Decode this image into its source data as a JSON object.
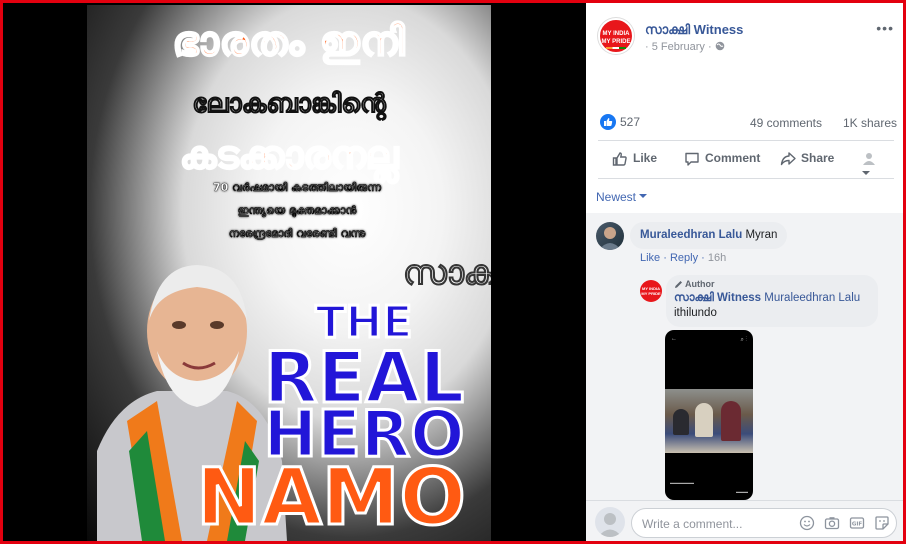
{
  "poster": {
    "line1": "ഭാരതം ഇനി",
    "line2": "ലോകബാങ്കിന്റെ",
    "line3": "കടക്കാരനല്ല",
    "line4": "70 വർഷമായി കടത്തിലായിരുന്ന",
    "line5": "ഇന്ത്യയെ മുക്തമാക്കാൻ",
    "line6": "നരേന്ദ്രമോദി വരേണ്ടി വന്നു",
    "watermark": "സാക്ഷി",
    "hero_the": "THE",
    "hero_real": "REAL",
    "hero_hero": "HERO",
    "hero_namo": "NAMO"
  },
  "post": {
    "page_name": "സാക്ഷി Witness",
    "date": "5 February",
    "date_separator": "·",
    "avatar_text": "MY INDIA MY PRIDE",
    "more": "•••"
  },
  "stats": {
    "reactions": "527",
    "comments": "49 comments",
    "shares": "1K shares"
  },
  "actions": {
    "like": "Like",
    "comment": "Comment",
    "share": "Share"
  },
  "sort": {
    "label": "Newest"
  },
  "comment1": {
    "author": "Muraleedhran Lalu",
    "text": "Myran",
    "like": "Like",
    "reply": "Reply",
    "time": "16h"
  },
  "comment2": {
    "author_tag": "Author",
    "author": "സാക്ഷി Witness",
    "mention": "Muraleedhran Lalu",
    "text": "ithilundo",
    "avatar_text": "MY INDIA MY PRIDE"
  },
  "composer": {
    "placeholder": "Write a comment..."
  },
  "colors": {
    "link": "#385898",
    "accent_red": "#e3000f",
    "poster_orange": "#ff5a12",
    "poster_blue": "#2216d8"
  },
  "icons": {
    "like": "thumbs-up-icon",
    "comment": "speech-bubble-icon",
    "share": "share-arrow-icon",
    "audience": "globe-icon"
  }
}
